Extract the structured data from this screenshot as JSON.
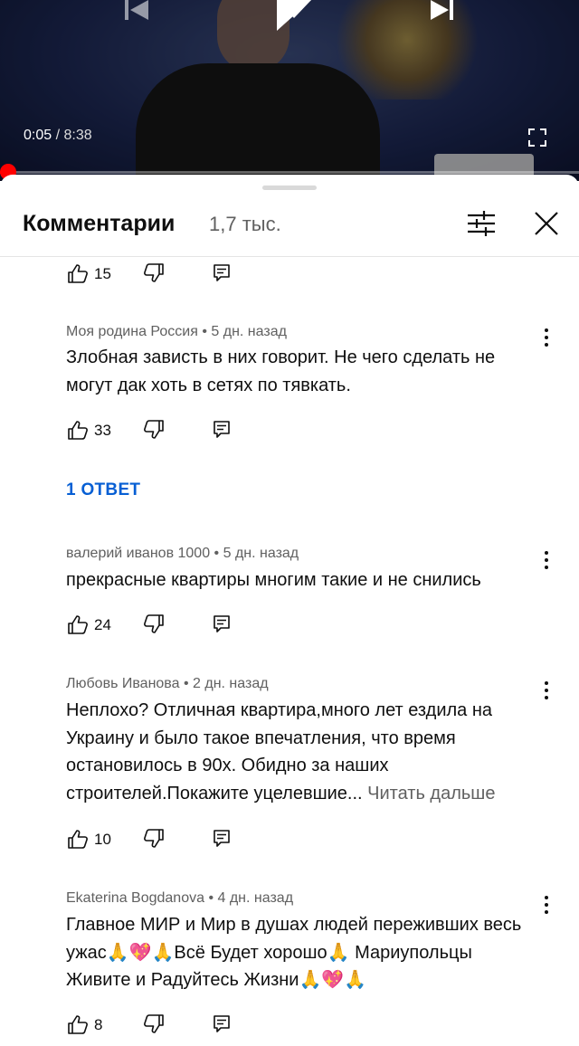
{
  "player": {
    "current_time": "0:05",
    "separator": " / ",
    "duration": "8:38",
    "progress": 0.0097,
    "accent_color": "#ff0000",
    "icons": [
      "skip-previous-icon",
      "play-icon",
      "skip-next-icon",
      "fullscreen-icon"
    ]
  },
  "comments_panel": {
    "title": "Комментарии",
    "count": "1,7 тыс.",
    "icons": [
      "filter-icon",
      "close-icon"
    ]
  },
  "comments": [
    {
      "likes": "15"
    },
    {
      "author": "Моя родина Россия",
      "age": "5 дн. назад",
      "text": "Злобная зависть в них говорит. Не чего сделать не могут дак хоть в сетях по тявкать.",
      "likes": "33",
      "replies_label": "1 ОТВЕТ"
    },
    {
      "author": "валерий иванов 1000",
      "age": "5 дн. назад",
      "text": "прекрасные квартиры многим такие и не снились",
      "likes": "24"
    },
    {
      "author": "Любовь Иванова",
      "age": "2 дн. назад",
      "text": "Неплохо? Отличная квартира,много лет ездила на Украину и было такое впечатления, что время остановилось в 90х. Обидно за наших строителей.Покажите уцелевшие...",
      "read_more": "Читать дальше",
      "likes": "10"
    },
    {
      "author": "Ekaterina Bogdanova",
      "age": "4 дн. назад",
      "text": "Главное МИР и Мир в душах людей переживших весь ужас🙏💖🙏Всё Будет  хорошо🙏 Мариупольцы Живите и Радуйтесь Жизни🙏💖🙏",
      "likes": "8"
    }
  ],
  "colors": {
    "link_blue": "#065fd4",
    "secondary_text": "#606060",
    "primary_text": "#0f0f0f"
  }
}
